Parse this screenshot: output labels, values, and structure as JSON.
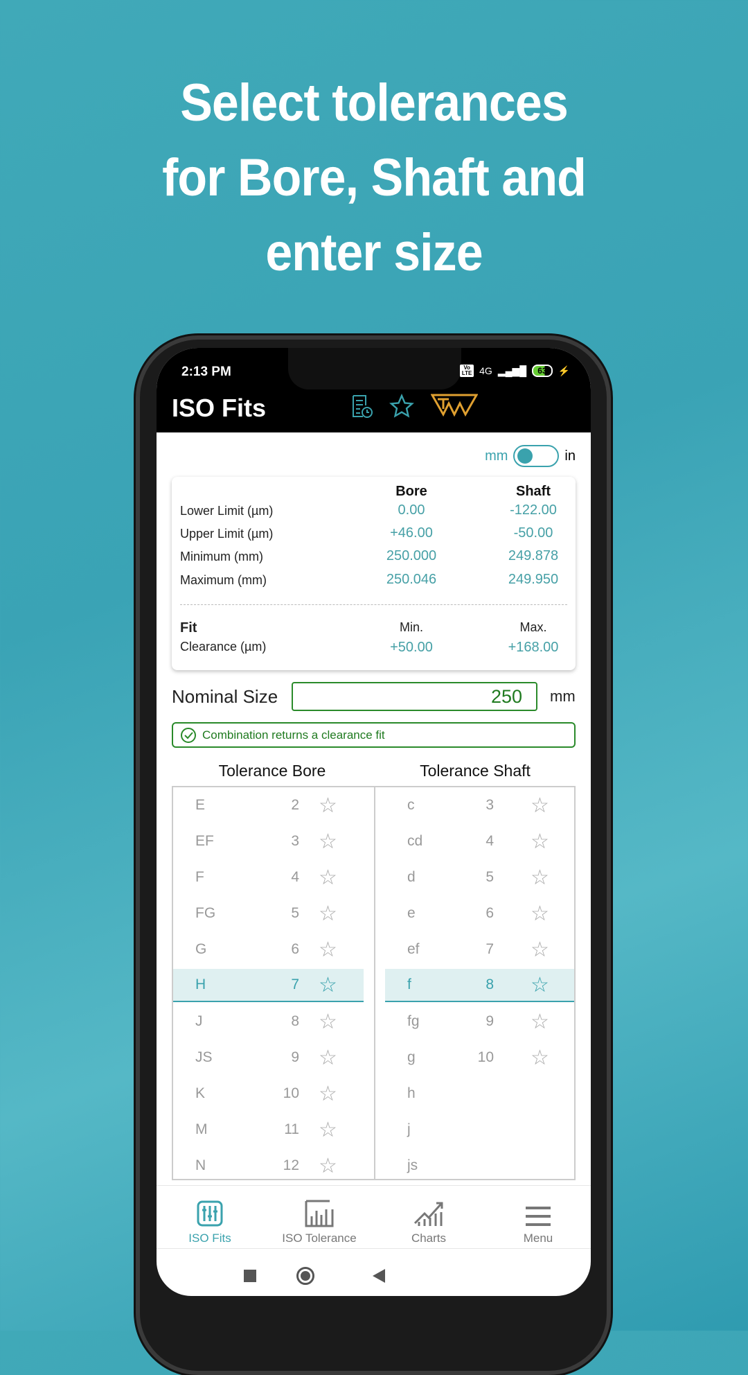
{
  "hero": {
    "line1": "Select tolerances",
    "line2": "for Bore, Shaft and",
    "line3": "enter size"
  },
  "status": {
    "time": "2:13 PM",
    "network": "4G",
    "battery": "63",
    "volte": "Vo LTE"
  },
  "app": {
    "title": "ISO Fits",
    "icons": [
      "history-document-icon",
      "star-icon",
      "tw-logo"
    ]
  },
  "units": {
    "left": "mm",
    "right": "in",
    "selected": "mm"
  },
  "results": {
    "col_bore": "Bore",
    "col_shaft": "Shaft",
    "rows": [
      {
        "label": "Lower Limit (µm)",
        "bore": "0.00",
        "shaft": "-122.00"
      },
      {
        "label": "Upper Limit (µm)",
        "bore": "+46.00",
        "shaft": "-50.00"
      },
      {
        "label": "Minimum (mm)",
        "bore": "250.000",
        "shaft": "249.878"
      },
      {
        "label": "Maximum (mm)",
        "bore": "250.046",
        "shaft": "249.950"
      }
    ],
    "fit_label": "Fit",
    "min_label": "Min.",
    "max_label": "Max.",
    "clearance_label": "Clearance (µm)",
    "clearance_min": "+50.00",
    "clearance_max": "+168.00"
  },
  "nominal": {
    "label": "Nominal Size",
    "value": "250",
    "unit": "mm"
  },
  "banner": "Combination returns a clearance fit",
  "tolerance": {
    "bore_header": "Tolerance Bore",
    "shaft_header": "Tolerance Shaft",
    "bore_letters": [
      "E",
      "EF",
      "F",
      "FG",
      "G",
      "H",
      "J",
      "JS",
      "K",
      "M",
      "N"
    ],
    "bore_grades": [
      "2",
      "3",
      "4",
      "5",
      "6",
      "7",
      "8",
      "9",
      "10",
      "11",
      "12"
    ],
    "shaft_letters": [
      "c",
      "cd",
      "d",
      "e",
      "ef",
      "f",
      "fg",
      "g",
      "h",
      "j",
      "js"
    ],
    "shaft_grades": [
      "3",
      "4",
      "5",
      "6",
      "7",
      "8",
      "9",
      "10"
    ],
    "selected_bore": "H",
    "selected_bore_grade": "7",
    "selected_shaft": "f",
    "selected_shaft_grade": "8"
  },
  "nav": [
    {
      "label": "ISO Fits",
      "icon": "sliders-icon"
    },
    {
      "label": "ISO Tolerance",
      "icon": "bar-chart-icon"
    },
    {
      "label": "Charts",
      "icon": "trend-chart-icon"
    },
    {
      "label": "Menu",
      "icon": "menu-icon"
    }
  ],
  "colors": {
    "accent": "#3aa2ad",
    "ok": "#2a8a2a",
    "logo": "#e0a030"
  }
}
